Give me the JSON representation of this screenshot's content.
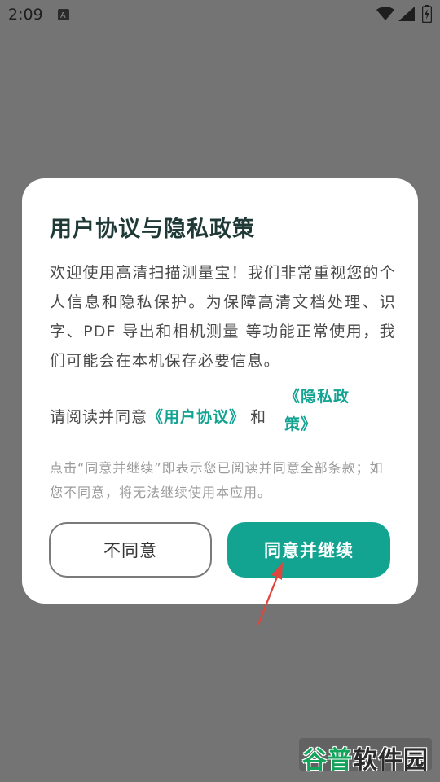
{
  "status_bar": {
    "time": "2:09",
    "icons": [
      "a-icon",
      "wifi-icon",
      "signal-icon",
      "battery-charging-icon"
    ]
  },
  "dialog": {
    "title": "用户协议与隐私政策",
    "body": "欢迎使用高清扫描测量宝！我们非常重视您的个人信息和隐私保护。为保障高清文档处理、识字、PDF 导出和相机测量 等功能正常使用，我们可能会在本机保存必要信息。",
    "prompt_prefix": "请阅读并同意",
    "user_agreement_link": "《用户协议》",
    "and_text": "和",
    "privacy_policy_link": "《隐私政策》",
    "notice": "点击“同意并继续”即表示您已阅读并同意全部条款；如您不同意，将无法继续使用本应用。",
    "disagree_label": "不同意",
    "agree_label": "同意并继续"
  },
  "watermark": {
    "text_a": "谷普",
    "text_b": "软件园"
  },
  "colors": {
    "accent": "#12a391",
    "overlay": "#747474",
    "arrow": "#e0463e"
  }
}
